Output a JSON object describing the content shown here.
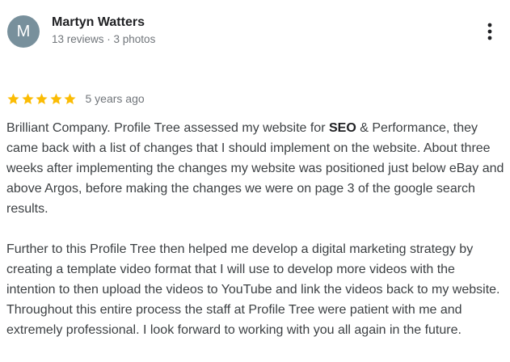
{
  "reviewer": {
    "initial": "M",
    "avatar_color": "#78909c",
    "name": "Martyn Watters",
    "meta": "13 reviews · 3 photos"
  },
  "menu_icon": "more-vertical-icon",
  "rating": {
    "stars": 5,
    "max": 5,
    "star_color": "#fbbc04",
    "time": "5 years ago"
  },
  "review": {
    "p1_before": "Brilliant Company. Profile Tree assessed my website for ",
    "p1_bold": "SEO",
    "p1_after": " & Performance, they came back with a list of changes that I should implement on the website. About three weeks after implementing the changes my website was positioned just below eBay and above Argos, before making the changes we were on page 3 of the google search results.",
    "p2": "Further to this Profile Tree then helped me develop a digital marketing strategy by creating a template video format that I will use to develop more videos with the intention to then upload the videos to YouTube and link the videos back to my website. Throughout this entire process the staff at Profile Tree were patient with me and extremely professional. I look forward to working with you all again in the future."
  }
}
